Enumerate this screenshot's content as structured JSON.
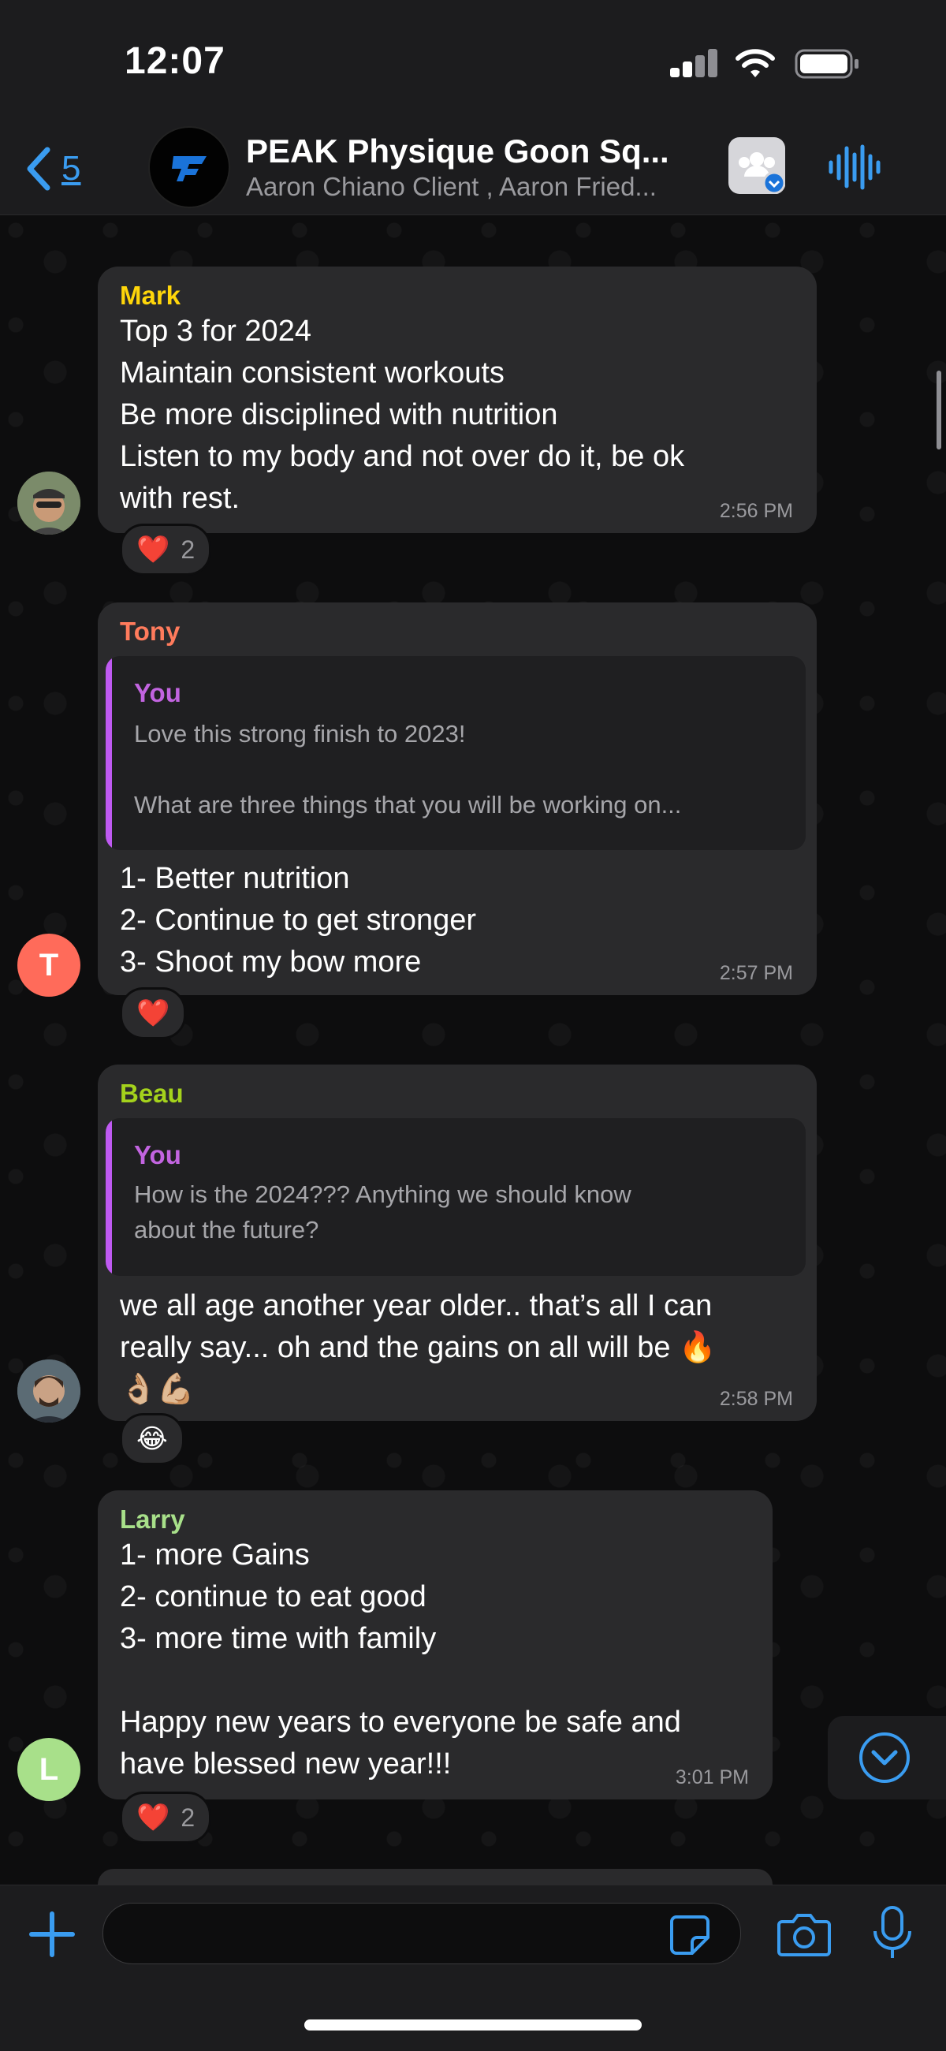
{
  "status": {
    "time": "12:07"
  },
  "header": {
    "back_count": "5",
    "title": "PEAK Physique Goon Sq...",
    "subtitle": "Aaron Chiano Client , Aaron Fried..."
  },
  "messages": [
    {
      "sender": "Mark",
      "sender_color": "#ffd60a",
      "text": "Top 3 for 2024\nMaintain consistent workouts\nBe more disciplined with nutrition\nListen to my body and not over do it, be ok\nwith rest.",
      "time": "2:56 PM",
      "reaction": "❤️",
      "reaction_count": "2"
    },
    {
      "sender": "Tony",
      "sender_color": "#ff7b5c",
      "avatar_letter": "T",
      "quote_name": "You",
      "quote_text": "Love this strong finish to 2023!\n\nWhat are three things that you will be working on...",
      "text": "1- Better nutrition\n2- Continue to get stronger\n3- Shoot my bow more",
      "time": "2:57 PM",
      "reaction": "❤️"
    },
    {
      "sender": "Beau",
      "sender_color": "#a4d21c",
      "quote_name": "You",
      "quote_text": "How is the 2024??? Anything we should know\nabout the future?",
      "text": "we all age another year older.. that’s all I can\nreally say... oh and the gains on all will be 🔥\n👌🏼💪🏼",
      "time": "2:58 PM",
      "reaction": "😂"
    },
    {
      "sender": "Larry",
      "sender_color": "#a8e08a",
      "avatar_letter": "L",
      "text": "1- more Gains\n2- continue to eat good\n3- more time with family\n\nHappy new years to everyone be safe and\nhave blessed new year!!!",
      "time": "3:01 PM",
      "reaction": "❤️",
      "reaction_count": "2"
    }
  ],
  "icons": {
    "back": "chevron-left-icon",
    "members": "group-icon",
    "audio": "waveform-icon",
    "plus": "plus-icon",
    "sticker": "sticker-icon",
    "camera": "camera-icon",
    "mic": "microphone-icon",
    "scroll_down": "chevron-down-circle-icon"
  },
  "colors": {
    "accent": "#3a9cf0",
    "bubble": "#2a2a2c",
    "header": "#1c1c1e"
  }
}
